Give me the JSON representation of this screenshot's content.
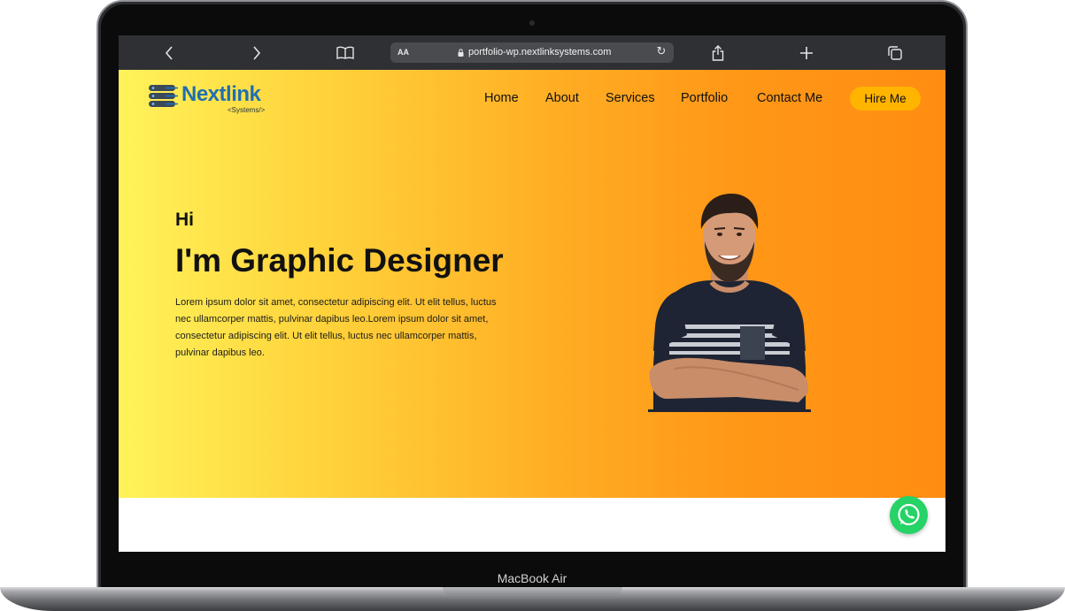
{
  "browser": {
    "address_text": "AA",
    "url": "portfolio-wp.nextlinksystems.com"
  },
  "site": {
    "logo_name": "Nextlink",
    "logo_sub": "<Systems/>",
    "nav": [
      "Home",
      "About",
      "Services",
      "Portfolio",
      "Contact Me"
    ],
    "cta": "Hire Me"
  },
  "hero": {
    "greeting": "Hi",
    "title": "I'm Graphic Designer",
    "body": "Lorem ipsum dolor sit amet, consectetur adipiscing elit. Ut elit tellus, luctus nec ullamcorper mattis, pulvinar dapibus leo.Lorem ipsum dolor sit amet, consectetur adipiscing elit. Ut elit tellus, luctus nec ullamcorper mattis, pulvinar dapibus leo."
  },
  "device": {
    "label": "MacBook Air"
  },
  "icons": {
    "back": "chevron-left-icon",
    "forward": "chevron-right-icon",
    "reader": "book-icon",
    "lock": "lock-icon",
    "reload": "reload-icon",
    "share": "share-icon",
    "new_tab": "plus-icon",
    "tabs": "tabs-icon",
    "chat": "whatsapp-icon"
  },
  "colors": {
    "toolbar": "#2f3033",
    "gradient_start": "#fff35a",
    "gradient_end": "#ff8d12",
    "cta": "#ffb400",
    "logo": "#1f6fb3",
    "whatsapp": "#25d366"
  }
}
